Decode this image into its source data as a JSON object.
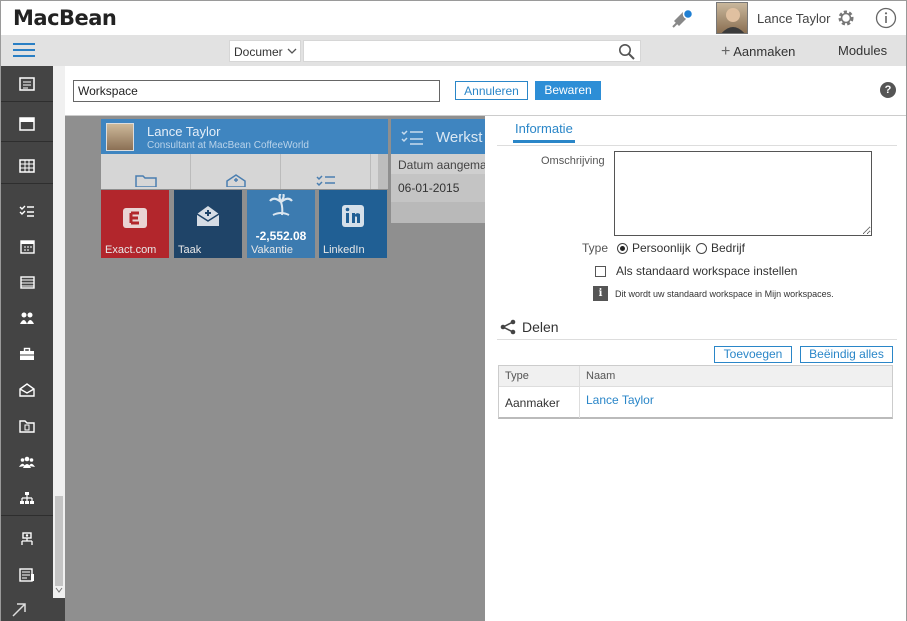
{
  "app": {
    "logo": "MacBean"
  },
  "user": {
    "name": "Lance Taylor"
  },
  "navbar": {
    "search_type": "Documer",
    "search_placeholder": "",
    "create_label": "Aanmaken",
    "modules_label": "Modules"
  },
  "edit": {
    "workspace_value": "Workspace",
    "cancel_label": "Annuleren",
    "save_label": "Bewaren",
    "help_label": "?"
  },
  "background": {
    "profile_name": "Lance Taylor",
    "profile_role": "Consultant at MacBean CoffeeWorld",
    "ws_card_title": "Werkst",
    "ws_card_column": "Datum aangema",
    "ws_card_value": "06-01-2015",
    "tiles": [
      {
        "label": "Exact.com",
        "color": "#c0262e",
        "icon": "exact-logo-icon"
      },
      {
        "label": "Taak",
        "color": "#1b4a78",
        "icon": "envelope-task-icon"
      },
      {
        "label": "Vakantie",
        "value": "-2,552.08",
        "color": "#2a7fc4",
        "icon": "palm-tree-icon"
      },
      {
        "label": "LinkedIn",
        "color": "#1d5f97",
        "icon": "linkedin-icon"
      }
    ]
  },
  "panel": {
    "tab_label": "Informatie",
    "description_label": "Omschrijving",
    "type_label": "Type",
    "type_options": [
      "Persoonlijk",
      "Bedrijf"
    ],
    "type_selected": "Persoonlijk",
    "default_checkbox_label": "Als standaard workspace instellen",
    "note_icon_text": "i",
    "note_text": "Dit wordt uw standaard workspace in Mijn workspaces.",
    "share_label": "Delen",
    "add_label": "Toevoegen",
    "end_all_label": "Beëindig alles",
    "table": {
      "headers": [
        "Type",
        "Naam"
      ],
      "rows": [
        {
          "type": "Aanmaker",
          "name": "Lance Taylor"
        }
      ]
    }
  },
  "colors": {
    "accent": "#2a86c8",
    "rail": "#444444",
    "overlay": "#8f8f8f"
  }
}
